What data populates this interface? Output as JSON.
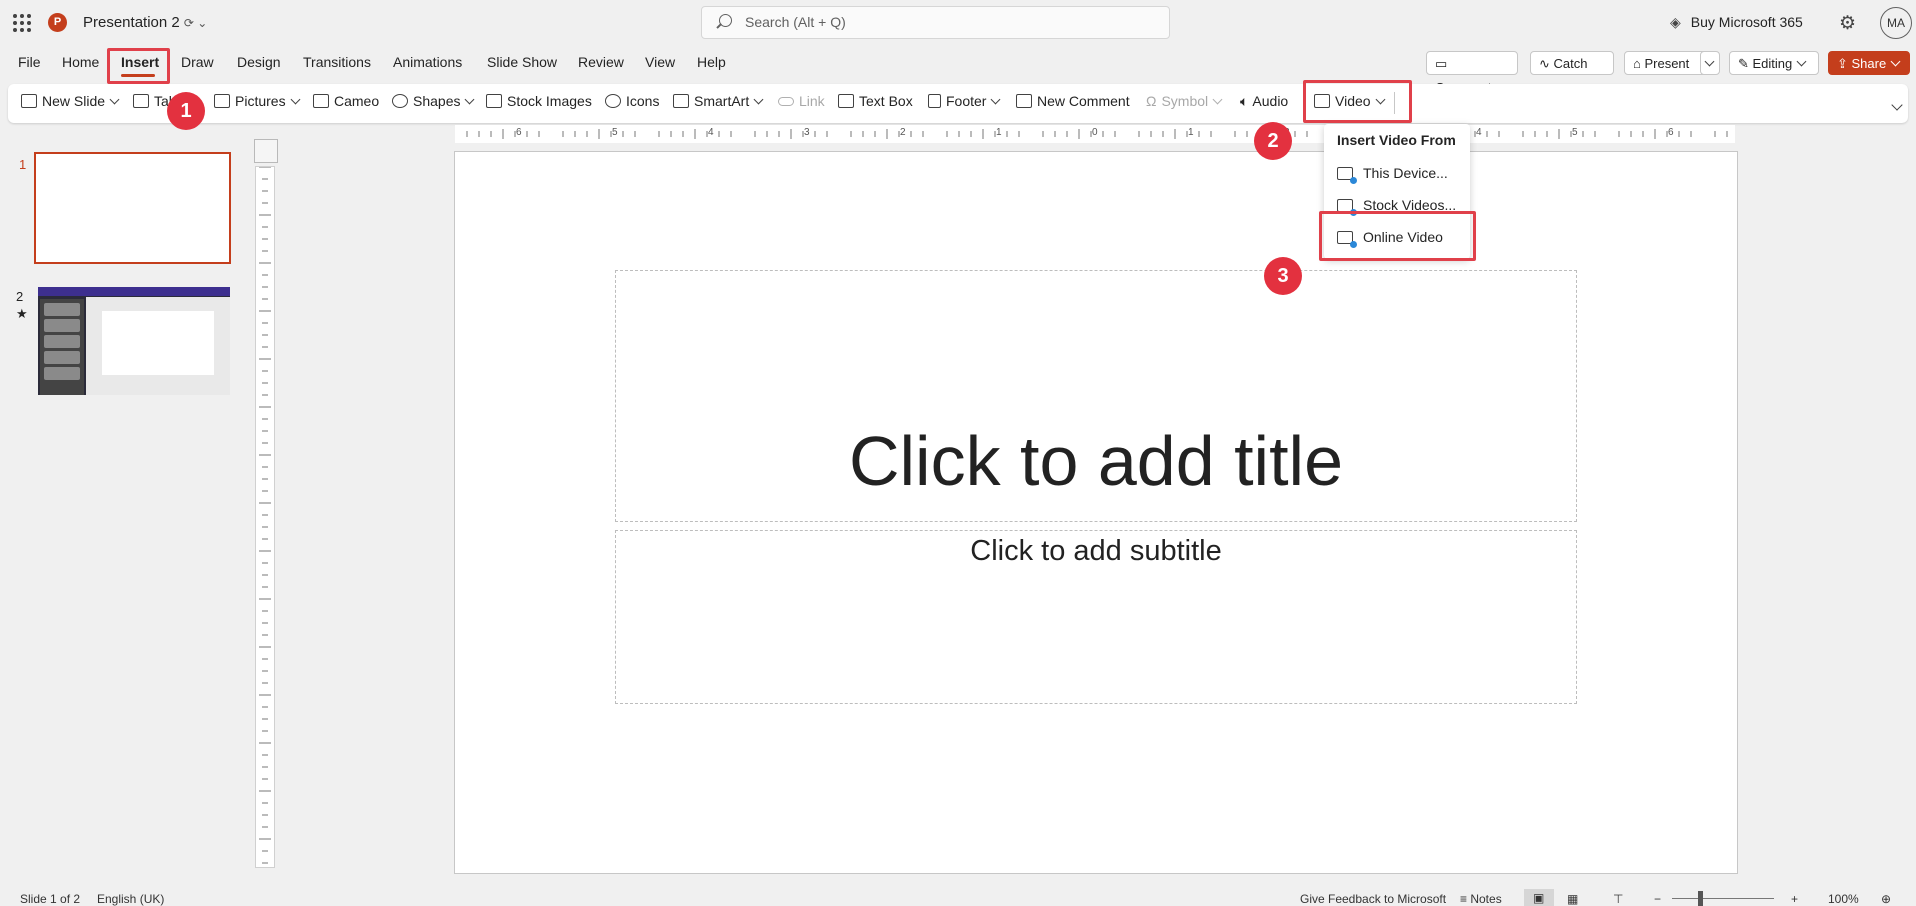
{
  "titlebar": {
    "app_logo": "P",
    "doc_title": "Presentation 2",
    "search_placeholder": "Search (Alt + Q)",
    "buy_label": "Buy Microsoft 365",
    "avatar_initials": "MA"
  },
  "menu_tabs": [
    "File",
    "Home",
    "Insert",
    "Draw",
    "Design",
    "Transitions",
    "Animations",
    "Slide Show",
    "Review",
    "View",
    "Help"
  ],
  "active_tab": "Insert",
  "top_buttons": {
    "comments": "Comments",
    "catchup": "Catch up",
    "present": "Present",
    "editing": "Editing",
    "share": "Share"
  },
  "ribbon": {
    "new_slide": "New Slide",
    "table": "Table",
    "pictures": "Pictures",
    "cameo": "Cameo",
    "shapes": "Shapes",
    "stock_images": "Stock Images",
    "icons": "Icons",
    "smartart": "SmartArt",
    "link": "Link",
    "text_box": "Text Box",
    "footer": "Footer",
    "new_comment": "New Comment",
    "symbol": "Symbol",
    "audio": "Audio",
    "video": "Video"
  },
  "video_menu": {
    "header": "Insert Video From",
    "items": [
      "This Device...",
      "Stock Videos...",
      "Online Video"
    ]
  },
  "slides_panel": {
    "slide1_num": "1",
    "slide2_num": "2",
    "slide2_star": "★"
  },
  "slide": {
    "title_placeholder": "Click to add title",
    "subtitle_placeholder": "Click to add subtitle"
  },
  "ruler": {
    "h_labels": [
      "6",
      "5",
      "4",
      "3",
      "2",
      "1",
      "0",
      "1",
      "2",
      "3",
      "4",
      "5",
      "6"
    ]
  },
  "markers": [
    "1",
    "2",
    "3"
  ],
  "status_bar": {
    "slide_count": "Slide 1 of 2",
    "language": "English (UK)",
    "feedback": "Give Feedback to Microsoft",
    "notes": "Notes",
    "zoom": "100%"
  },
  "colors": {
    "accent": "#c43e1c",
    "annotation": "#e3313f"
  }
}
